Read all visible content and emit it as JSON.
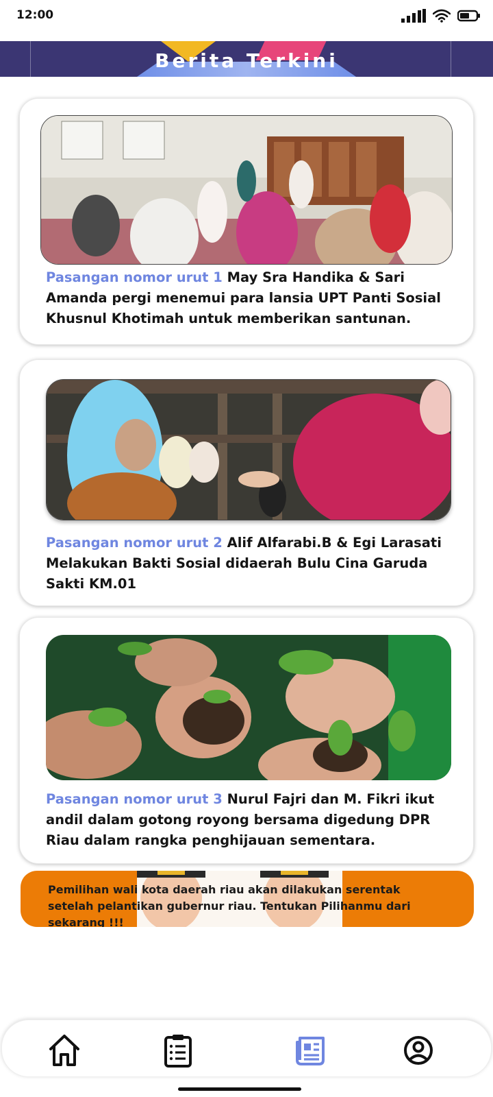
{
  "status_bar": {
    "time": "12:00",
    "icons": [
      "signal-icon",
      "wifi-icon",
      "battery-icon"
    ]
  },
  "header": {
    "title": "Berita Terkini",
    "background_color": "#3b3673"
  },
  "news": [
    {
      "highlight": "Pasangan nomor urut 1",
      "body": " May Sra Handika & Sari Amanda pergi menemui para lansia UPT Panti Sosial Khusnul Khotimah untuk memberikan santunan.",
      "image": "photo-elderly-gathering"
    },
    {
      "highlight": "Pasangan nomor urut 2",
      "body": " Alif Alfarabi.B & Egi Larasati Melakukan Bakti Sosial didaerah Bulu Cina Garuda Sakti KM.01",
      "image": "photo-handing-aid"
    },
    {
      "highlight": "Pasangan nomor urut 3",
      "body": " Nurul Fajri dan M. Fikri ikut andil dalam gotong royong bersama digedung DPR Riau dalam rangka penghijauan sementara.",
      "image": "photo-hands-seedlings"
    }
  ],
  "banner": {
    "text": "Pemilihan wali kota daerah riau akan dilakukan serentak setelah pelantikan gubernur riau. Tentukan Pilihanmu dari sekarang !!!",
    "background_color": "#ec7c06"
  },
  "bottom_nav": {
    "items": [
      {
        "icon": "home-icon",
        "active": false
      },
      {
        "icon": "clipboard-list-icon",
        "active": false
      },
      {
        "icon": "newspaper-icon",
        "active": true
      },
      {
        "icon": "user-circle-icon",
        "active": false
      }
    ],
    "active_color": "#6f86e0",
    "inactive_color": "#111111"
  }
}
